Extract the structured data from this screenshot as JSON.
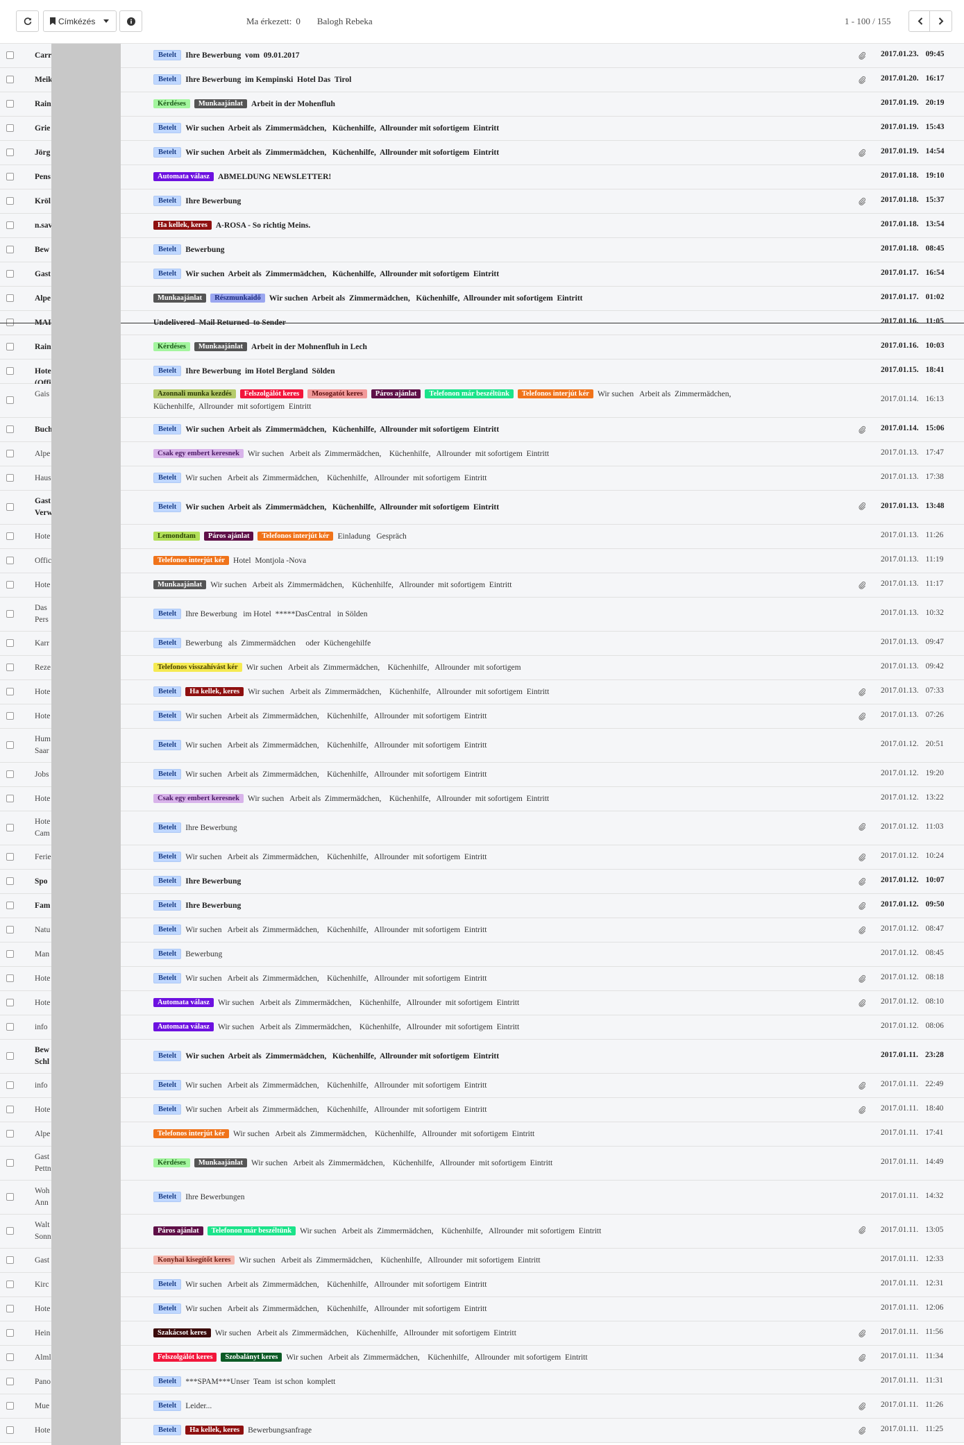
{
  "toolbar": {
    "label_button": "Címkézés",
    "today_label": "Ma érkezett:",
    "today_count": "0",
    "user_name": "Balogh Rebeka",
    "paging": "1 - 100 / 155"
  },
  "labels": {
    "Betelt": {
      "bg": "#bfd7ff",
      "fg": "#1d3f86"
    },
    "Kérdéses": {
      "bg": "#a3f59e",
      "fg": "#1d5b1a"
    },
    "Munkaajánlat": {
      "bg": "#555555",
      "fg": "#ffffff"
    },
    "Automata válasz": {
      "bg": "#6d11e0",
      "fg": "#ffffff"
    },
    "Ha kellek, keres": {
      "bg": "#8e1010",
      "fg": "#ffffff"
    },
    "Részmunkaidő": {
      "bg": "#9aa6ef",
      "fg": "#1c2a7d"
    },
    "Azonnali munka kezdés": {
      "bg": "#b5cb6a",
      "fg": "#2c3b06"
    },
    "Felszolgálót keres": {
      "bg": "#f2163b",
      "fg": "#ffffff"
    },
    "Mosogatót keres": {
      "bg": "#f29a9a",
      "fg": "#5c1010"
    },
    "Páros ajánlat": {
      "bg": "#5e0f47",
      "fg": "#ffffff"
    },
    "Telefonon már beszéltünk": {
      "bg": "#1be38a",
      "fg": "#ffffff"
    },
    "Telefonos interjút kér": {
      "bg": "#f0731a",
      "fg": "#ffffff"
    },
    "Csak egy embert keresnek": {
      "bg": "#d8b3ea",
      "fg": "#4b1a64"
    },
    "Lemondtam": {
      "bg": "#b2df59",
      "fg": "#2c4505"
    },
    "Telefonos visszahívást kér": {
      "bg": "#f5ea52",
      "fg": "#4a4300"
    },
    "Konyhai kisegítőt keres": {
      "bg": "#f4b6ad",
      "fg": "#6e1e12"
    },
    "Szakácsot keres": {
      "bg": "#3b0b0b",
      "fg": "#ffffff"
    },
    "Szobalányt keres": {
      "bg": "#0b5a25",
      "fg": "#ffffff"
    }
  },
  "emails": [
    {
      "sender": "Carr",
      "labels": [
        "Betelt"
      ],
      "subject": "Ihre Bewerbung  vom  09.01.2017",
      "attach": true,
      "date": "2017.01.23.",
      "time": "09:45",
      "unread": true
    },
    {
      "sender": "Meik",
      "labels": [
        "Betelt"
      ],
      "subject": "Ihre Bewerbung  im Kempinski  Hotel Das  Tirol",
      "attach": true,
      "date": "2017.01.20.",
      "time": "16:17",
      "unread": true
    },
    {
      "sender": "Rain",
      "labels": [
        "Kérdéses",
        "Munkaajánlat"
      ],
      "subject": "Arbeit in der Mohenfluh",
      "attach": false,
      "date": "2017.01.19.",
      "time": "20:19",
      "unread": true
    },
    {
      "sender": "Grie",
      "labels": [
        "Betelt"
      ],
      "subject": "Wir suchen  Arbeit als  Zimmermädchen,   Küchenhilfe,  Allrounder mit sofortigem  Eintritt",
      "attach": false,
      "date": "2017.01.19.",
      "time": "15:43",
      "unread": true
    },
    {
      "sender": "Jörg",
      "labels": [
        "Betelt"
      ],
      "subject": "Wir suchen  Arbeit als  Zimmermädchen,   Küchenhilfe,  Allrounder mit sofortigem  Eintritt",
      "attach": true,
      "date": "2017.01.19.",
      "time": "14:54",
      "unread": true
    },
    {
      "sender": "Pens",
      "labels": [
        "Automata válasz"
      ],
      "subject": "ABMELDUNG NEWSLETTER!",
      "attach": false,
      "date": "2017.01.18.",
      "time": "19:10",
      "unread": true
    },
    {
      "sender": "Kröl",
      "labels": [
        "Betelt"
      ],
      "subject": "Ihre Bewerbung",
      "attach": true,
      "date": "2017.01.18.",
      "time": "15:37",
      "unread": true
    },
    {
      "sender": "n.sav",
      "labels": [
        "Ha kellek, keres"
      ],
      "subject": "A-ROSA - So richtig Meins.",
      "attach": false,
      "date": "2017.01.18.",
      "time": "13:54",
      "unread": true
    },
    {
      "sender": "Bew",
      "labels": [
        "Betelt"
      ],
      "subject": "Bewerbung",
      "attach": false,
      "date": "2017.01.18.",
      "time": "08:45",
      "unread": true
    },
    {
      "sender": "Gast",
      "labels": [
        "Betelt"
      ],
      "subject": "Wir suchen  Arbeit als  Zimmermädchen,   Küchenhilfe,  Allrounder mit sofortigem  Eintritt",
      "attach": false,
      "date": "2017.01.17.",
      "time": "16:54",
      "unread": true
    },
    {
      "sender": "Alpe                 of",
      "labels": [
        "Munkaajánlat",
        "Részmunkaidő"
      ],
      "subject": "Wir suchen  Arbeit als  Zimmermädchen,   Küchenhilfe,  Allrounder mit sofortigem  Eintritt",
      "attach": false,
      "date": "2017.01.17.",
      "time": "01:02",
      "unread": true
    },
    {
      "sender": "MAI",
      "labels": [],
      "subject": "Undelivered  Mail Returned  to Sender",
      "attach": false,
      "date": "2017.01.16.",
      "time": "11:05",
      "unread": true,
      "strike": true
    },
    {
      "sender": "Rain",
      "labels": [
        "Kérdéses",
        "Munkaajánlat"
      ],
      "subject": "Arbeit in der Mohnenfluh in Lech",
      "attach": false,
      "date": "2017.01.16.",
      "time": "10:03",
      "unread": true
    },
    {
      "sender": "Hote                 a\n(Offi",
      "labels": [
        "Betelt"
      ],
      "subject": "Ihre Bewerbung  im Hotel Bergland  Sölden",
      "attach": false,
      "date": "2017.01.15.",
      "time": "18:41",
      "unread": true
    },
    {
      "sender": "Gais",
      "labels": [
        "Azonnali munka kezdés",
        "Felszolgálót keres",
        "Mosogatót keres",
        "Páros ajánlat",
        "Telefonon már beszéltünk",
        "Telefonos interjút kér"
      ],
      "subject": "Wir suchen   Arbeit als  Zimmermädchen,\nKüchenhilfe,  Allrounder  mit sofortigem  Eintritt",
      "attach": false,
      "date": "2017.01.14.",
      "time": "16:13",
      "unread": false,
      "tall": true
    },
    {
      "sender": "Buch",
      "labels": [
        "Betelt"
      ],
      "subject": "Wir suchen  Arbeit als  Zimmermädchen,   Küchenhilfe,  Allrounder mit sofortigem  Eintritt",
      "attach": true,
      "date": "2017.01.14.",
      "time": "15:06",
      "unread": true
    },
    {
      "sender": "Alpe",
      "labels": [
        "Csak egy embert keresnek"
      ],
      "subject": "Wir suchen   Arbeit als  Zimmermädchen,    Küchenhilfe,   Allrounder  mit sofortigem  Eintritt",
      "attach": false,
      "date": "2017.01.13.",
      "time": "17:47",
      "unread": false
    },
    {
      "sender": "Haus",
      "labels": [
        "Betelt"
      ],
      "subject": "Wir suchen   Arbeit als  Zimmermädchen,    Küchenhilfe,   Allrounder  mit sofortigem  Eintritt",
      "attach": false,
      "date": "2017.01.13.",
      "time": "17:38",
      "unread": false
    },
    {
      "sender": "Gast\nVerw",
      "labels": [
        "Betelt"
      ],
      "subject": "Wir suchen  Arbeit als  Zimmermädchen,   Küchenhilfe,  Allrounder mit sofortigem  Eintritt",
      "attach": true,
      "date": "2017.01.13.",
      "time": "13:48",
      "unread": true,
      "tall": true
    },
    {
      "sender": "Hote",
      "labels": [
        "Lemondtam",
        "Páros ajánlat",
        "Telefonos interjút kér"
      ],
      "subject": "Einladung   Gespräch",
      "attach": false,
      "date": "2017.01.13.",
      "time": "11:26",
      "unread": false
    },
    {
      "sender": "Offic",
      "labels": [
        "Telefonos interjút kér"
      ],
      "subject": "Hotel  Montjola -Nova",
      "attach": false,
      "date": "2017.01.13.",
      "time": "11:19",
      "unread": false
    },
    {
      "sender": "Hote",
      "labels": [
        "Munkaajánlat"
      ],
      "subject": "Wir suchen   Arbeit als  Zimmermädchen,    Küchenhilfe,   Allrounder  mit sofortigem  Eintritt",
      "attach": true,
      "date": "2017.01.13.",
      "time": "11:17",
      "unread": false
    },
    {
      "sender": "Das\nPers",
      "labels": [
        "Betelt"
      ],
      "subject": "Ihre Bewerbung   im Hotel  *****DasCentral   in Sölden",
      "attach": false,
      "date": "2017.01.13.",
      "time": "10:32",
      "unread": false,
      "tall": true
    },
    {
      "sender": "Karr",
      "labels": [
        "Betelt"
      ],
      "subject": "Bewerbung   als  Zimmermädchen     oder  Küchengehilfe",
      "attach": false,
      "date": "2017.01.13.",
      "time": "09:47",
      "unread": false
    },
    {
      "sender": "Reze",
      "labels": [
        "Telefonos visszahívást kér"
      ],
      "subject": "Wir suchen   Arbeit als  Zimmermädchen,    Küchenhilfe,   Allrounder  mit sofortigem",
      "attach": false,
      "date": "2017.01.13.",
      "time": "09:42",
      "unread": false
    },
    {
      "sender": "Hote",
      "labels": [
        "Betelt",
        "Ha kellek, keres"
      ],
      "subject": "Wir suchen   Arbeit als  Zimmermädchen,    Küchenhilfe,   Allrounder  mit sofortigem  Eintritt",
      "attach": true,
      "date": "2017.01.13.",
      "time": "07:33",
      "unread": false
    },
    {
      "sender": "Hote",
      "labels": [
        "Betelt"
      ],
      "subject": "Wir suchen   Arbeit als  Zimmermädchen,    Küchenhilfe,   Allrounder  mit sofortigem  Eintritt",
      "attach": true,
      "date": "2017.01.13.",
      "time": "07:26",
      "unread": false
    },
    {
      "sender": "Hum\nSaar",
      "labels": [
        "Betelt"
      ],
      "subject": "Wir suchen   Arbeit als  Zimmermädchen,    Küchenhilfe,   Allrounder  mit sofortigem  Eintritt",
      "attach": false,
      "date": "2017.01.12.",
      "time": "20:51",
      "unread": false,
      "tall": true
    },
    {
      "sender": "Jobs",
      "labels": [
        "Betelt"
      ],
      "subject": "Wir suchen   Arbeit als  Zimmermädchen,    Küchenhilfe,   Allrounder  mit sofortigem  Eintritt",
      "attach": false,
      "date": "2017.01.12.",
      "time": "19:20",
      "unread": false
    },
    {
      "sender": "Hote",
      "labels": [
        "Csak egy embert keresnek"
      ],
      "subject": "Wir suchen   Arbeit als  Zimmermädchen,    Küchenhilfe,   Allrounder  mit sofortigem  Eintritt",
      "attach": false,
      "date": "2017.01.12.",
      "time": "13:22",
      "unread": false
    },
    {
      "sender": "Hote                 Vino\nCam",
      "labels": [
        "Betelt"
      ],
      "subject": "Ihre Bewerbung",
      "attach": true,
      "date": "2017.01.12.",
      "time": "11:03",
      "unread": false,
      "tall": true
    },
    {
      "sender": "Ferie",
      "labels": [
        "Betelt"
      ],
      "subject": "Wir suchen   Arbeit als  Zimmermädchen,    Küchenhilfe,   Allrounder  mit sofortigem  Eintritt",
      "attach": true,
      "date": "2017.01.12.",
      "time": "10:24",
      "unread": false
    },
    {
      "sender": "Spo",
      "labels": [
        "Betelt"
      ],
      "subject": "Ihre Bewerbung",
      "attach": true,
      "date": "2017.01.12.",
      "time": "10:07",
      "unread": true
    },
    {
      "sender": "Fam",
      "labels": [
        "Betelt"
      ],
      "subject": "Ihre Bewerbung",
      "attach": true,
      "date": "2017.01.12.",
      "time": "09:50",
      "unread": true
    },
    {
      "sender": "Natu",
      "labels": [
        "Betelt"
      ],
      "subject": "Wir suchen   Arbeit als  Zimmermädchen,    Küchenhilfe,   Allrounder  mit sofortigem  Eintritt",
      "attach": true,
      "date": "2017.01.12.",
      "time": "08:47",
      "unread": false
    },
    {
      "sender": "Man",
      "labels": [
        "Betelt"
      ],
      "subject": "Bewerbung",
      "attach": false,
      "date": "2017.01.12.",
      "time": "08:45",
      "unread": false
    },
    {
      "sender": "Hote",
      "labels": [
        "Betelt"
      ],
      "subject": "Wir suchen   Arbeit als  Zimmermädchen,    Küchenhilfe,   Allrounder  mit sofortigem  Eintritt",
      "attach": true,
      "date": "2017.01.12.",
      "time": "08:18",
      "unread": false
    },
    {
      "sender": "Hote                 rtal",
      "labels": [
        "Automata válasz"
      ],
      "subject": "Wir suchen   Arbeit als  Zimmermädchen,    Küchenhilfe,   Allrounder  mit sofortigem  Eintritt",
      "attach": true,
      "date": "2017.01.12.",
      "time": "08:10",
      "unread": false
    },
    {
      "sender": "info",
      "labels": [
        "Automata válasz"
      ],
      "subject": "Wir suchen   Arbeit als  Zimmermädchen,    Küchenhilfe,   Allrounder  mit sofortigem  Eintritt",
      "attach": false,
      "date": "2017.01.12.",
      "time": "08:06",
      "unread": false
    },
    {
      "sender": "Bew\nSchl                 oyal",
      "labels": [
        "Betelt"
      ],
      "subject": "Wir suchen  Arbeit als  Zimmermädchen,   Küchenhilfe,  Allrounder mit sofortigem  Eintritt",
      "attach": false,
      "date": "2017.01.11.",
      "time": "23:28",
      "unread": true,
      "tall": true
    },
    {
      "sender": "info",
      "labels": [
        "Betelt"
      ],
      "subject": "Wir suchen   Arbeit als  Zimmermädchen,    Küchenhilfe,   Allrounder  mit sofortigem  Eintritt",
      "attach": true,
      "date": "2017.01.11.",
      "time": "22:49",
      "unread": false
    },
    {
      "sender": "Hote",
      "labels": [
        "Betelt"
      ],
      "subject": "Wir suchen   Arbeit als  Zimmermädchen,    Küchenhilfe,   Allrounder  mit sofortigem  Eintritt",
      "attach": true,
      "date": "2017.01.11.",
      "time": "18:40",
      "unread": false
    },
    {
      "sender": "Alpe",
      "labels": [
        "Telefonos interjút kér"
      ],
      "subject": "Wir suchen   Arbeit als  Zimmermädchen,    Küchenhilfe,   Allrounder  mit sofortigem  Eintritt",
      "attach": false,
      "date": "2017.01.11.",
      "time": "17:41",
      "unread": false
    },
    {
      "sender": "Gast\nPettn",
      "labels": [
        "Kérdéses",
        "Munkaajánlat"
      ],
      "subject": "Wir suchen   Arbeit als  Zimmermädchen,    Küchenhilfe,   Allrounder  mit sofortigem  Eintritt",
      "attach": false,
      "date": "2017.01.11.",
      "time": "14:49",
      "unread": false,
      "tall": true
    },
    {
      "sender": "Woh                  –\nAnn",
      "labels": [
        "Betelt"
      ],
      "subject": "Ihre Bewerbungen",
      "attach": false,
      "date": "2017.01.11.",
      "time": "14:32",
      "unread": false,
      "tall": true
    },
    {
      "sender": "Walt\nSonn",
      "labels": [
        "Páros ajánlat",
        "Telefonon már beszéltünk"
      ],
      "subject": "Wir suchen   Arbeit als  Zimmermädchen,    Küchenhilfe,   Allrounder  mit sofortigem  Eintritt",
      "attach": true,
      "date": "2017.01.11.",
      "time": "13:05",
      "unread": false,
      "tall": true
    },
    {
      "sender": "Gast",
      "labels": [
        "Konyhai kisegítőt keres"
      ],
      "subject": "Wir suchen   Arbeit als  Zimmermädchen,    Küchenhilfe,   Allrounder  mit sofortigem  Eintritt",
      "attach": false,
      "date": "2017.01.11.",
      "time": "12:33",
      "unread": false
    },
    {
      "sender": "Kirc",
      "labels": [
        "Betelt"
      ],
      "subject": "Wir suchen   Arbeit als  Zimmermädchen,    Küchenhilfe,   Allrounder  mit sofortigem  Eintritt",
      "attach": false,
      "date": "2017.01.11.",
      "time": "12:31",
      "unread": false
    },
    {
      "sender": "Hote",
      "labels": [
        "Betelt"
      ],
      "subject": "Wir suchen   Arbeit als  Zimmermädchen,    Küchenhilfe,   Allrounder  mit sofortigem  Eintritt",
      "attach": false,
      "date": "2017.01.11.",
      "time": "12:06",
      "unread": false
    },
    {
      "sender": "Hein",
      "labels": [
        "Szakácsot keres"
      ],
      "subject": "Wir suchen   Arbeit als  Zimmermädchen,    Küchenhilfe,   Allrounder  mit sofortigem  Eintritt",
      "attach": true,
      "date": "2017.01.11.",
      "time": "11:56",
      "unread": false
    },
    {
      "sender": "Alml",
      "labels": [
        "Felszolgálót keres",
        "Szobalányt keres"
      ],
      "subject": "Wir suchen   Arbeit als  Zimmermädchen,    Küchenhilfe,   Allrounder  mit sofortigem  Eintritt",
      "attach": true,
      "date": "2017.01.11.",
      "time": "11:34",
      "unread": false
    },
    {
      "sender": "Pano                 berg",
      "labels": [],
      "subject": "***SPAM***Unser  Team  ist schon  komplett",
      "attach": false,
      "date": "2017.01.11.",
      "time": "11:31",
      "unread": false,
      "forceBetelt": true
    },
    {
      "sender": "Mue",
      "labels": [
        "Betelt"
      ],
      "subject": "Leider...",
      "attach": true,
      "date": "2017.01.11.",
      "time": "11:26",
      "unread": false
    },
    {
      "sender": "Hote",
      "labels": [
        "Betelt",
        "Ha kellek, keres"
      ],
      "subject": "Bewerbungsanfrage",
      "attach": true,
      "date": "2017.01.11.",
      "time": "11:25",
      "unread": false
    }
  ]
}
